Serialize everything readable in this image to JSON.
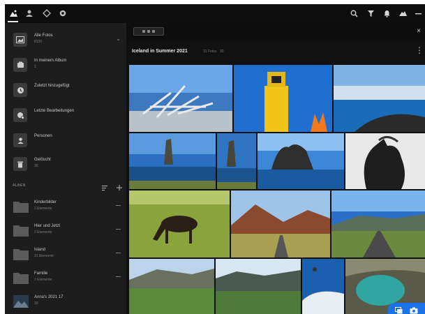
{
  "toolbar": {
    "left_icons": [
      "photos-icon",
      "people-icon",
      "places-icon",
      "settings-icon"
    ],
    "right_icons": [
      "search-icon",
      "filter-icon",
      "notification-icon",
      "cloud-icon",
      "minimize-icon"
    ]
  },
  "sidebar": {
    "items": [
      {
        "label": "Alle Fotos",
        "count": "8130",
        "icon": "photos-thumbnail"
      },
      {
        "label": "In meinem Album",
        "count": "1",
        "icon": "album-icon"
      },
      {
        "label": "Zuletzt hinzugefügt",
        "count": "",
        "icon": "clock-icon"
      },
      {
        "label": "Letzte Bearbeitungen",
        "count": "",
        "icon": "edit-icon"
      },
      {
        "label": "Personen",
        "count": "",
        "icon": "people-icon"
      },
      {
        "label": "Gelöscht",
        "count": "30",
        "icon": "trash-icon"
      }
    ],
    "albums_header": "ALBEN",
    "albums": [
      {
        "label": "Kinderbilder",
        "count": "2 Elemente"
      },
      {
        "label": "Hier und Jetzt",
        "count": "2 Elemente"
      },
      {
        "label": "Island",
        "count": "31 Elemente"
      },
      {
        "label": "Familie",
        "count": "1 Elemente"
      },
      {
        "label": "Anna's 2021 17",
        "count": "30"
      }
    ]
  },
  "main": {
    "album_title": "Iceland in Summer 2021",
    "album_subtitle": "31 Fotos · 30",
    "close_label": "×",
    "photos": [
      "driftwood-sculpture",
      "yellow-lighthouse",
      "coastal-lagoon",
      "sea-stack-left",
      "sea-stack-right",
      "hvitserkur-rock",
      "horse-portrait",
      "grazing-horse",
      "mountain-road",
      "highway-distance",
      "green-valley",
      "mountain-lake",
      "aerial-coast",
      "turquoise-pool"
    ]
  },
  "colors": {
    "accent": "#1a73e8",
    "sidebar_bg": "#1d1d1d",
    "main_bg": "#111111",
    "topbar_bg": "#0e0e0e"
  }
}
